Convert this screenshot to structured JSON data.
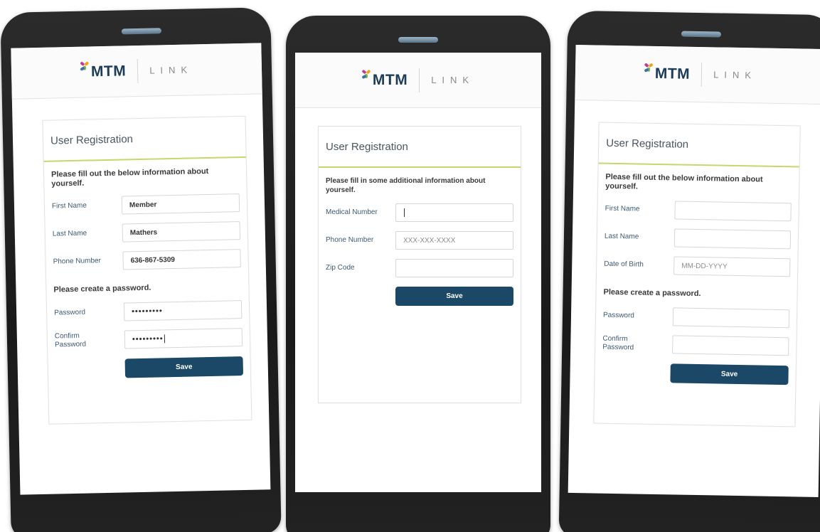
{
  "brand": {
    "name": "MTM",
    "product": "LINK"
  },
  "screens": [
    {
      "title": "User Registration",
      "instructions": "Please fill out the below information about yourself.",
      "fields": [
        {
          "label": "First Name",
          "value": "Member"
        },
        {
          "label": "Last Name",
          "value": "Mathers"
        },
        {
          "label": "Phone Number",
          "value": "636-867-5309"
        }
      ],
      "password_section": "Please create a password.",
      "password_fields": [
        {
          "label": "Password",
          "value": "•••••••••"
        },
        {
          "label": "Confirm Password",
          "value": "•••••••••"
        }
      ],
      "save_label": "Save"
    },
    {
      "title": "User Registration",
      "instructions": "Please fill in some additional information about yourself.",
      "fields": [
        {
          "label": "Medical Number",
          "value": ""
        },
        {
          "label": "Phone Number",
          "placeholder": "XXX-XXX-XXXX"
        },
        {
          "label": "Zip Code",
          "value": ""
        }
      ],
      "save_label": "Save"
    },
    {
      "title": "User Registration",
      "instructions": "Please fill out the below information about yourself.",
      "fields": [
        {
          "label": "First Name",
          "value": ""
        },
        {
          "label": "Last Name",
          "value": ""
        },
        {
          "label": "Date of Birth",
          "placeholder": "MM-DD-YYYY"
        }
      ],
      "password_section": "Please create a password.",
      "password_fields": [
        {
          "label": "Password",
          "value": ""
        },
        {
          "label": "Confirm Password",
          "value": ""
        }
      ],
      "save_label": "Save"
    }
  ],
  "colors": {
    "primary_button": "#1b4866",
    "accent_rule": "#c7d86a",
    "logo_text": "#1d3c57",
    "label_text": "#3e5a72"
  }
}
